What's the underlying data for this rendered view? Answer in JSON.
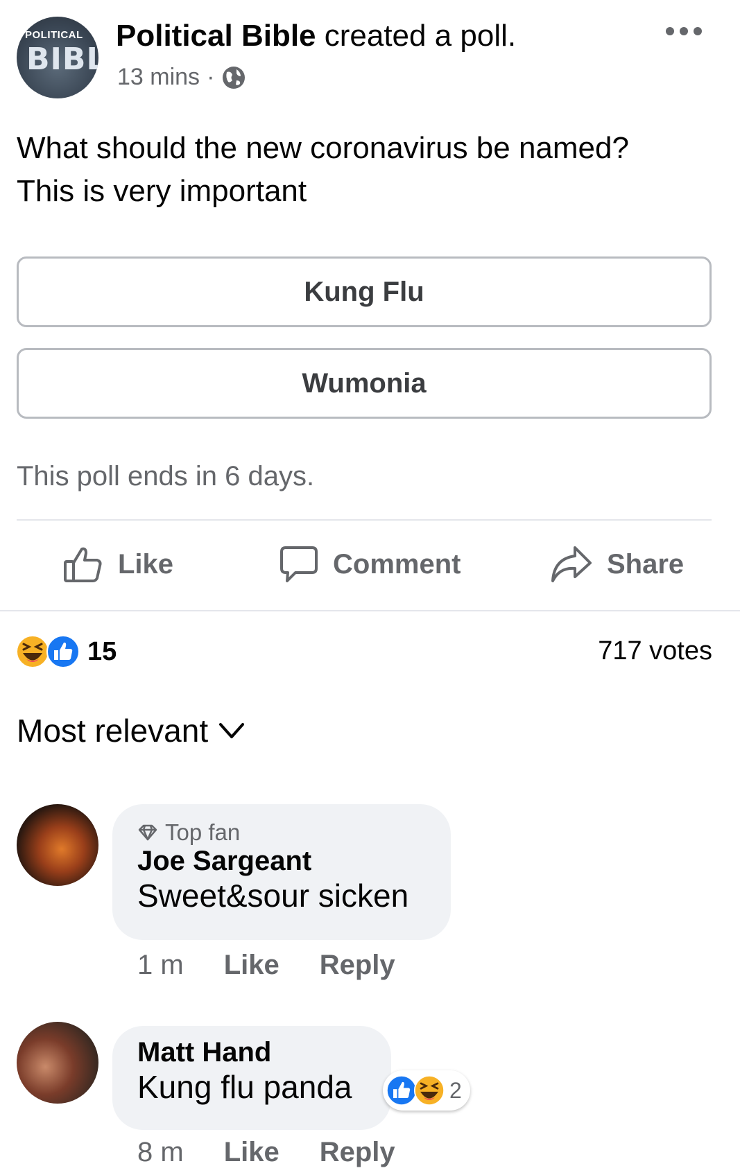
{
  "post": {
    "page_name": "Political Bible",
    "action_text": " created a poll.",
    "time": "13 mins",
    "dot": "·",
    "avatar_logo_top": "POLITICAL",
    "avatar_logo_main": "BIBLE",
    "text_line1": "What should the new coronavirus be named?",
    "text_line2": "This is very important"
  },
  "poll": {
    "options": [
      "Kung Flu",
      "Wumonia"
    ],
    "ends_text": "This poll ends in 6 days."
  },
  "actions": {
    "like": "Like",
    "comment": "Comment",
    "share": "Share"
  },
  "summary": {
    "reaction_count": "15",
    "votes": "717 votes"
  },
  "sort": {
    "label": "Most relevant"
  },
  "comments": [
    {
      "badge": "Top fan",
      "author": "Joe Sargeant",
      "text": "Sweet&sour sicken",
      "time": "1 m",
      "like": "Like",
      "reply": "Reply"
    },
    {
      "author": "Matt Hand",
      "text": "Kung flu panda",
      "time": "8 m",
      "like": "Like",
      "reply": "Reply",
      "reaction_count": "2"
    }
  ],
  "colors": {
    "secondary_text": "#65676b",
    "bubble": "#f0f2f5",
    "like_blue": "#1877f2",
    "haha_yellow": "#f7b125"
  },
  "icons": [
    "more-options-icon",
    "globe-icon",
    "like-icon",
    "comment-icon",
    "share-icon",
    "haha-reaction-icon",
    "like-reaction-icon",
    "chevron-down-icon",
    "diamond-icon"
  ]
}
